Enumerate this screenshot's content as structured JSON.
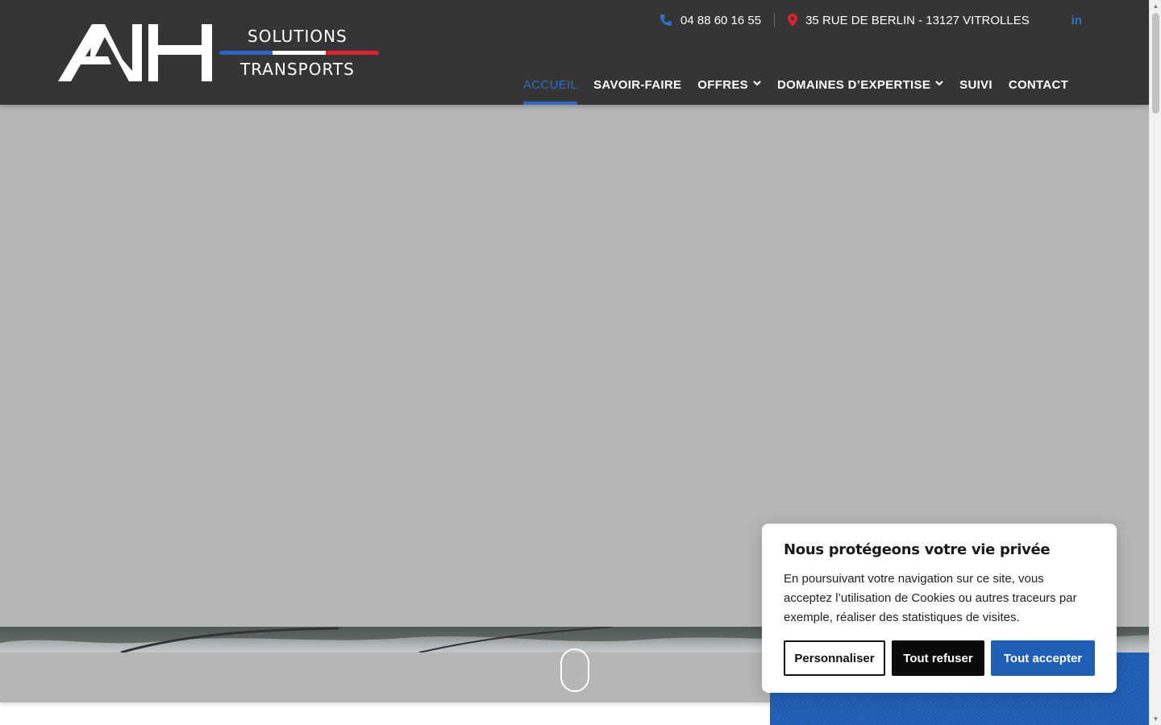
{
  "brand": {
    "logo_text": "ANH",
    "tagline_top": "SOLUTIONS",
    "tagline_bottom": "TRANSPORTS",
    "flag_colors": [
      "#2c63c8",
      "#ffffff",
      "#e01f30"
    ]
  },
  "topbar": {
    "phone": "04 88 60 16 55",
    "address": "35 RUE DE BERLIN - 13127 VITROLLES",
    "linkedin": "in",
    "phone_icon_color": "#2f6fce",
    "pin_icon_color": "#e01f30"
  },
  "nav": {
    "items": [
      {
        "label": "ACCUEIL",
        "active": true
      },
      {
        "label": "SAVOIR-FAIRE"
      },
      {
        "label": "OFFRES",
        "dropdown": true
      },
      {
        "label": "DOMAINES D’EXPERTISE",
        "dropdown": true
      },
      {
        "label": "SUIVI"
      },
      {
        "label": "CONTACT"
      }
    ]
  },
  "cookie": {
    "title": "Nous protégeons votre vie privée",
    "text": "En poursuivant votre navigation sur ce site, vous acceptez l’utilisation de Cookies ou autres traceurs par exemple, réaliser des statistiques de visites.",
    "customize": "Personnaliser",
    "refuse": "Tout refuser",
    "accept": "Tout accepter"
  },
  "colors": {
    "header_bg": "#353535",
    "accent_blue": "#2d6bc3",
    "hero_bg": "#b6b6b6"
  }
}
